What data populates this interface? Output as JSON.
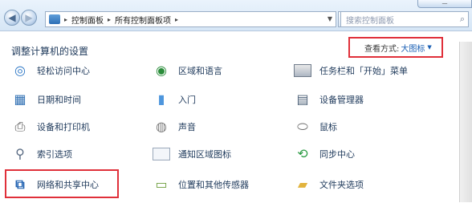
{
  "breadcrumb": {
    "items": [
      "控制面板",
      "所有控制面板项"
    ],
    "separator": "▸"
  },
  "search": {
    "placeholder": "搜索控制面板"
  },
  "header": {
    "title": "调整计算机的设置",
    "view_by_label": "查看方式:",
    "view_by_value": "大图标",
    "view_arrow": "▼"
  },
  "items": [
    {
      "label": "轻松访问中心",
      "icon": "ease-of-access-icon"
    },
    {
      "label": "区域和语言",
      "icon": "globe-icon"
    },
    {
      "label": "任务栏和「开始」菜单",
      "icon": "taskbar-icon"
    },
    {
      "label": "日期和时间",
      "icon": "clock-icon"
    },
    {
      "label": "入门",
      "icon": "getting-started-icon"
    },
    {
      "label": "设备管理器",
      "icon": "device-manager-icon"
    },
    {
      "label": "设备和打印机",
      "icon": "printer-icon"
    },
    {
      "label": "声音",
      "icon": "speaker-icon"
    },
    {
      "label": "鼠标",
      "icon": "mouse-icon"
    },
    {
      "label": "索引选项",
      "icon": "indexing-icon"
    },
    {
      "label": "通知区域图标",
      "icon": "notification-tray-icon"
    },
    {
      "label": "同步中心",
      "icon": "sync-icon"
    },
    {
      "label": "网络和共享中心",
      "icon": "network-icon"
    },
    {
      "label": "位置和其他传感器",
      "icon": "sensor-icon"
    },
    {
      "label": "文件夹选项",
      "icon": "folder-icon"
    }
  ],
  "colors": {
    "highlight_border": "#e0303a",
    "link_text": "#1e395b",
    "accent_blue": "#1a5fb4"
  }
}
